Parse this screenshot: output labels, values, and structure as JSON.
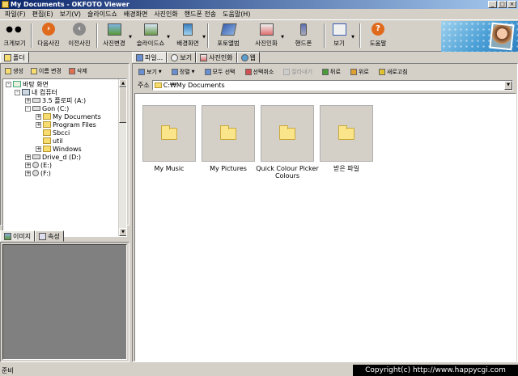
{
  "window": {
    "title": "My Documents - OKFOTO Viewer",
    "controls": [
      "_",
      "□",
      "×"
    ]
  },
  "menu": [
    "파일(F)",
    "편집(E)",
    "보기(V)",
    "슬라이드쇼",
    "배경화면",
    "사진인화",
    "핸드폰 전송",
    "도움말(H)"
  ],
  "toolbar": {
    "buttons": [
      {
        "label": "크게보기",
        "icon": "view-large-icon"
      },
      {
        "label": "다음사진",
        "icon": "next-arrow-icon",
        "color": "#e06a1c"
      },
      {
        "label": "이전사진",
        "icon": "prev-arrow-icon",
        "color": "#7a7a7a"
      },
      {
        "label": "사진변경",
        "icon": "photo-edit-icon"
      },
      {
        "label": "슬라이드쇼",
        "icon": "slideshow-icon"
      },
      {
        "label": "배경화면",
        "icon": "wallpaper-icon"
      },
      {
        "label": "포토앨범",
        "icon": "photo-album-icon"
      },
      {
        "label": "사진인화",
        "icon": "photo-print-icon"
      },
      {
        "label": "핸드폰",
        "icon": "mobile-phone-icon"
      },
      {
        "label": "보기",
        "icon": "view-icon"
      },
      {
        "label": "도움말",
        "icon": "help-icon",
        "color": "#e06a1c"
      }
    ]
  },
  "left": {
    "folder_tab": "폴더",
    "folder_toolbar": [
      "생성",
      "이름 변경",
      "삭제"
    ],
    "tree": [
      {
        "label": "바탕 화면",
        "icon": "desktop-icon",
        "expander": "-"
      },
      {
        "label": "내 컴퓨터",
        "icon": "my-computer-icon",
        "expander": "-"
      },
      {
        "label": "3.5 플로피 (A:)",
        "icon": "floppy-drive-icon",
        "expander": "+"
      },
      {
        "label": "Gon (C:)",
        "icon": "hard-drive-icon",
        "expander": "-"
      },
      {
        "label": "My Documents",
        "icon": "folder-icon",
        "expander": "+"
      },
      {
        "label": "Program Files",
        "icon": "folder-icon",
        "expander": "+"
      },
      {
        "label": "Sbcci",
        "icon": "folder-icon",
        "expander": ""
      },
      {
        "label": "util",
        "icon": "folder-icon",
        "expander": ""
      },
      {
        "label": "Windows",
        "icon": "folder-icon",
        "expander": "+"
      },
      {
        "label": "Drive_d (D:)",
        "icon": "hard-drive-icon",
        "expander": "+"
      },
      {
        "label": "(E:)",
        "icon": "cd-drive-icon",
        "expander": "+"
      },
      {
        "label": "(F:)",
        "icon": "cd-drive-icon",
        "expander": "+"
      }
    ],
    "image_tabs": [
      "이미지",
      "속성"
    ]
  },
  "right": {
    "tabs": [
      "파일...",
      "보기",
      "사진인화",
      "웹"
    ],
    "toolbar": [
      "보기",
      "정렬",
      "모두 선택",
      "선택취소",
      "잘라내기",
      "뒤로",
      "위로",
      "새로고침"
    ],
    "address_label": "주소",
    "address_value": "C:₩My Documents",
    "files": [
      {
        "name": "My Music"
      },
      {
        "name": "My Pictures"
      },
      {
        "name": "Quick Colour Picker Colours"
      },
      {
        "name": "받은 파일"
      }
    ]
  },
  "status": {
    "text": "준비",
    "copyright": "Copyright(c) http://www.happycgi.com"
  }
}
